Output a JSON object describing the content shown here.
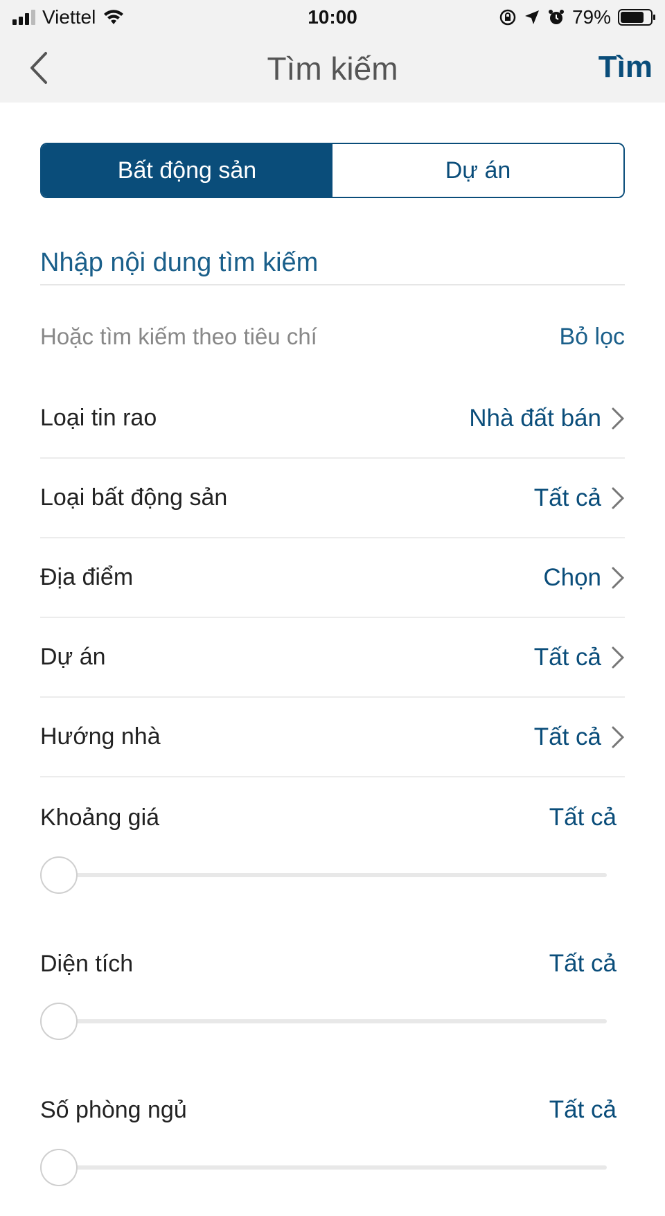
{
  "status_bar": {
    "carrier": "Viettel",
    "time": "10:00",
    "battery": "79%",
    "battery_level": 0.79,
    "icons": [
      "signal-icon",
      "wifi-icon",
      "orientation-lock-icon",
      "location-icon",
      "alarm-icon",
      "battery-icon"
    ]
  },
  "nav": {
    "back_icon": "chevron-left-icon",
    "title": "Tìm kiếm",
    "action": "Tìm"
  },
  "tabs": [
    {
      "label": "Bất động sản",
      "active": true
    },
    {
      "label": "Dự án",
      "active": false
    }
  ],
  "search": {
    "placeholder": "Nhập nội dung tìm kiếm",
    "value": ""
  },
  "criteria": {
    "label": "Hoặc tìm kiếm theo tiêu chí",
    "clear": "Bỏ lọc"
  },
  "list": [
    {
      "label": "Loại tin rao",
      "value": "Nhà đất bán"
    },
    {
      "label": "Loại bất động sản",
      "value": "Tất cả"
    },
    {
      "label": "Địa điểm",
      "value": "Chọn"
    },
    {
      "label": "Dự án",
      "value": "Tất cả"
    },
    {
      "label": "Hướng nhà",
      "value": "Tất cả"
    }
  ],
  "sliders": [
    {
      "label": "Khoảng giá",
      "value": "Tất cả",
      "position": 0
    },
    {
      "label": "Diện tích",
      "value": "Tất cả",
      "position": 0
    },
    {
      "label": "Số phòng ngủ",
      "value": "Tất cả",
      "position": 0
    }
  ],
  "colors": {
    "accent": "#0a4d7a",
    "link": "#1a5f8a",
    "bar_background": "#f2f2f2"
  }
}
